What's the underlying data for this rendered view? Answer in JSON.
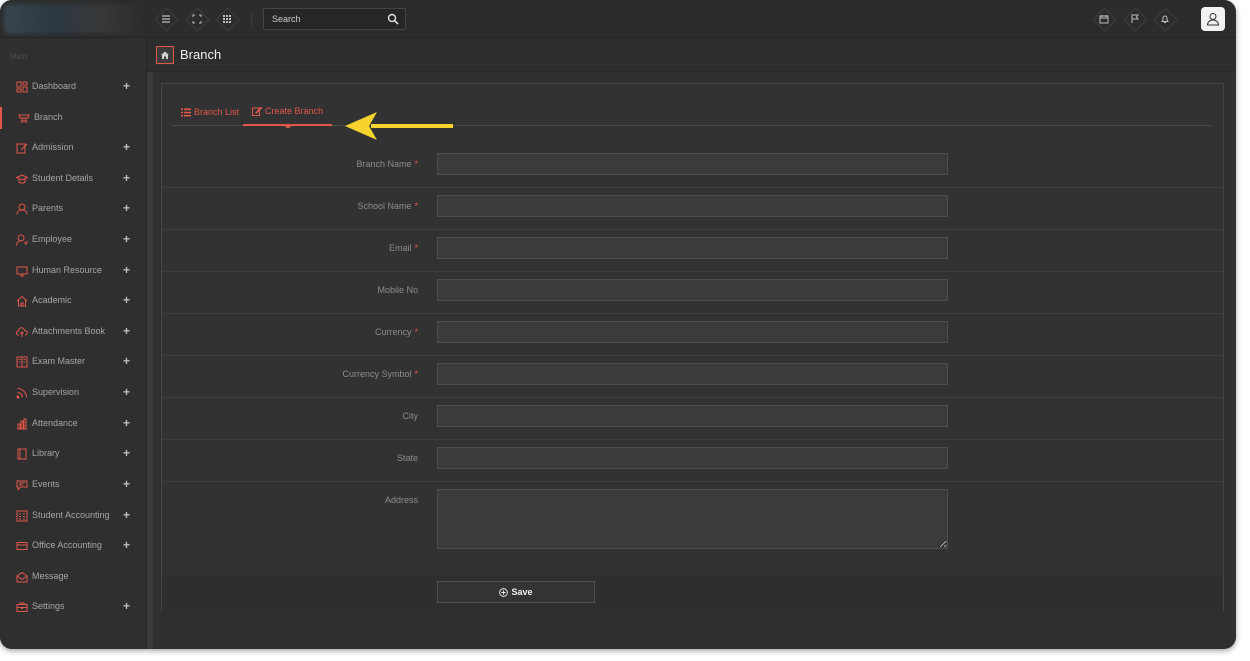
{
  "header": {
    "search_placeholder": "Search",
    "icons": [
      "menu-icon",
      "fullscreen-icon",
      "apps-grid-icon",
      "search-icon",
      "calendar-icon",
      "flag-icon",
      "bell-icon",
      "user-icon"
    ]
  },
  "sidebar": {
    "section_label": "Main",
    "items": [
      {
        "label": "Dashboard",
        "icon": "dashboard-icon",
        "has_plus": true,
        "active": false
      },
      {
        "label": "Branch",
        "icon": "branch-icon",
        "has_plus": false,
        "active": true
      },
      {
        "label": "Admission",
        "icon": "admission-icon",
        "has_plus": true,
        "active": false
      },
      {
        "label": "Student Details",
        "icon": "graduation-cap-icon",
        "has_plus": true,
        "active": false
      },
      {
        "label": "Parents",
        "icon": "parents-icon",
        "has_plus": true,
        "active": false
      },
      {
        "label": "Employee",
        "icon": "employee-icon",
        "has_plus": true,
        "active": false
      },
      {
        "label": "Human Resource",
        "icon": "monitor-icon",
        "has_plus": true,
        "active": false
      },
      {
        "label": "Academic",
        "icon": "home-icon",
        "has_plus": true,
        "active": false
      },
      {
        "label": "Attachments Book",
        "icon": "cloud-upload-icon",
        "has_plus": true,
        "active": false
      },
      {
        "label": "Exam Master",
        "icon": "book-icon",
        "has_plus": true,
        "active": false
      },
      {
        "label": "Supervision",
        "icon": "rss-icon",
        "has_plus": true,
        "active": false
      },
      {
        "label": "Attendance",
        "icon": "bar-chart-icon",
        "has_plus": true,
        "active": false
      },
      {
        "label": "Library",
        "icon": "library-icon",
        "has_plus": true,
        "active": false
      },
      {
        "label": "Events",
        "icon": "message-icon",
        "has_plus": true,
        "active": false
      },
      {
        "label": "Student Accounting",
        "icon": "ledger-icon",
        "has_plus": true,
        "active": false
      },
      {
        "label": "Office Accounting",
        "icon": "credit-card-icon",
        "has_plus": true,
        "active": false
      },
      {
        "label": "Message",
        "icon": "envelope-icon",
        "has_plus": false,
        "active": false
      },
      {
        "label": "Settings",
        "icon": "briefcase-icon",
        "has_plus": true,
        "active": false
      }
    ],
    "plus": "+"
  },
  "page": {
    "title": "Branch"
  },
  "tabs": [
    {
      "label": "Branch List",
      "icon": "list-icon",
      "active": false
    },
    {
      "label": "Create Branch",
      "icon": "edit-icon",
      "active": true
    }
  ],
  "form": {
    "required_mark": "*",
    "fields": [
      {
        "label": "Branch Name",
        "required": true,
        "value": ""
      },
      {
        "label": "School Name",
        "required": true,
        "value": ""
      },
      {
        "label": "Email",
        "required": true,
        "value": ""
      },
      {
        "label": "Mobile No",
        "required": false,
        "value": ""
      },
      {
        "label": "Currency",
        "required": true,
        "value": ""
      },
      {
        "label": "Currency Symbol",
        "required": true,
        "value": ""
      },
      {
        "label": "City",
        "required": false,
        "value": ""
      },
      {
        "label": "State",
        "required": false,
        "value": ""
      }
    ],
    "address_label": "Address",
    "address_value": "",
    "save_label": "Save"
  },
  "colors": {
    "accent": "#e2574c",
    "annotation_arrow": "#f6d32d",
    "background": "#2f2f2f"
  }
}
